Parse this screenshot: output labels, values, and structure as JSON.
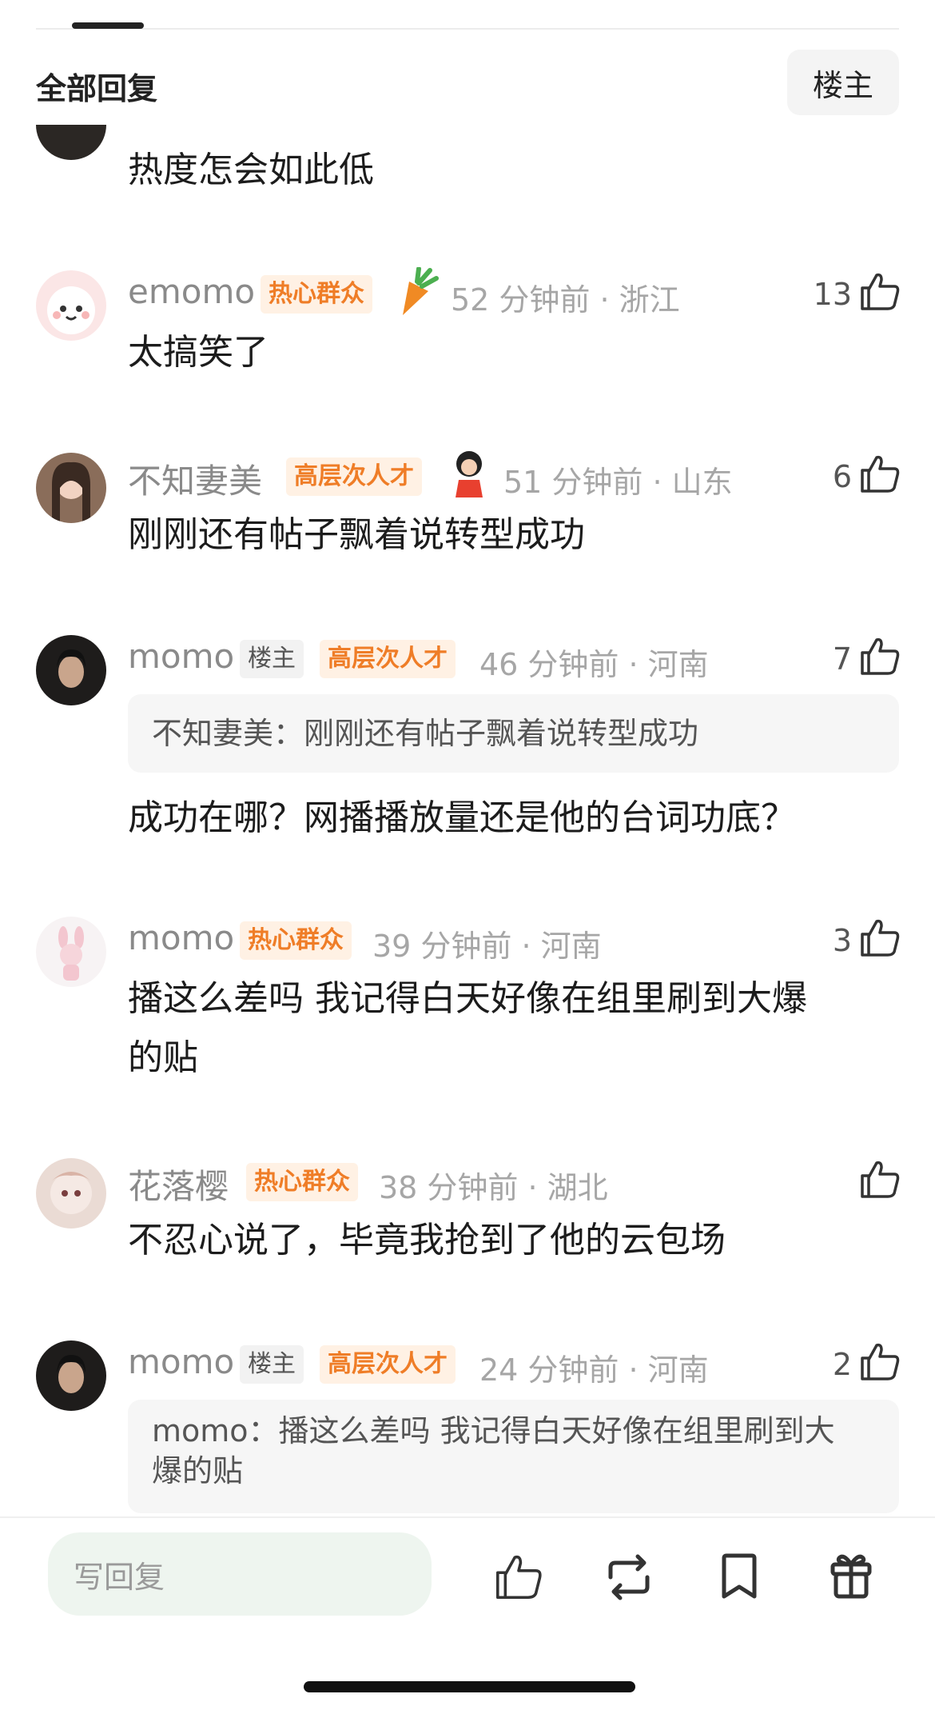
{
  "header": {
    "title": "全部回复",
    "filter_label": "楼主"
  },
  "comments": [
    {
      "content": "热度怎会如此低"
    },
    {
      "nickname": "emomo",
      "badges": [
        "热心群众"
      ],
      "time_location": "52 分钟前 · 浙江",
      "likes": "13",
      "content": "太搞笑了"
    },
    {
      "nickname": "不知妻美",
      "badges": [
        "高层次人才"
      ],
      "time_location": "51 分钟前 · 山东",
      "likes": "6",
      "content": "刚刚还有帖子飘着说转型成功"
    },
    {
      "nickname": "momo",
      "badges": [
        "楼主",
        "高层次人才"
      ],
      "time_location": "46 分钟前 · 河南",
      "likes": "7",
      "quote": "不知妻美：刚刚还有帖子飘着说转型成功",
      "content": "成功在哪？网播播放量还是他的台词功底？"
    },
    {
      "nickname": "momo",
      "badges": [
        "热心群众"
      ],
      "time_location": "39 分钟前 · 河南",
      "likes": "3",
      "content_line1": "播这么差吗 我记得白天好像在组里刷到大爆",
      "content_line2": "的贴"
    },
    {
      "nickname": "花落樱",
      "badges": [
        "热心群众"
      ],
      "time_location": "38 分钟前 · 湖北",
      "likes": "",
      "content": "不忍心说了，毕竟我抢到了他的云包场"
    },
    {
      "nickname": "momo",
      "badges": [
        "楼主",
        "高层次人才"
      ],
      "time_location": "24 分钟前 · 河南",
      "likes": "2",
      "quote_line1": "momo：播这么差吗 我记得白天好像在组里刷到大",
      "quote_line2": "爆的贴"
    }
  ],
  "bottom_bar": {
    "reply_placeholder": "写回复",
    "icons": [
      "thumb-up-icon",
      "repost-icon",
      "bookmark-icon",
      "gift-icon"
    ]
  },
  "colors": {
    "badge_orange": "#ef7d27",
    "badge_orange_bg": "#fff1e4",
    "reply_bg": "#eef5ef"
  }
}
